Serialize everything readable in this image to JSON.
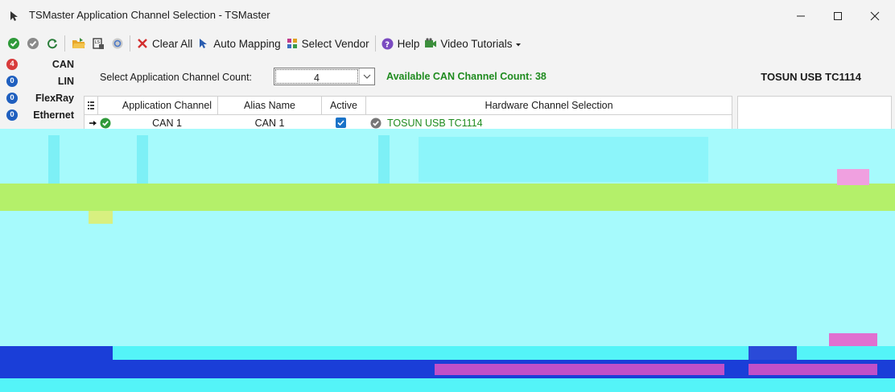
{
  "window": {
    "title": "TSMaster Application Channel Selection - TSMaster",
    "minimize": "minimize",
    "maximize": "maximize",
    "close": "close"
  },
  "toolbar": {
    "icons": [
      "ok-icon",
      "cancel-icon",
      "refresh-icon",
      "open-folder-icon",
      "save-config-icon",
      "reset-icon"
    ],
    "clear_all": "Clear All",
    "auto_mapping": "Auto Mapping",
    "select_vendor": "Select Vendor",
    "help": "Help",
    "video_tutorials": "Video Tutorials"
  },
  "categories": [
    {
      "name": "CAN",
      "count": "4",
      "color": "#d83b3b"
    },
    {
      "name": "LIN",
      "count": "0",
      "color": "#1f5fbf"
    },
    {
      "name": "FlexRay",
      "count": "0",
      "color": "#1f5fbf"
    },
    {
      "name": "Ethernet",
      "count": "0",
      "color": "#1f5fbf"
    }
  ],
  "selection": {
    "label": "Select Application Channel Count:",
    "count": "4",
    "available": "Available CAN Channel Count: 38",
    "device": "TOSUN USB TC1114"
  },
  "grid": {
    "headers": [
      "Application Channel",
      "Alias Name",
      "Active",
      "Hardware Channel Selection"
    ],
    "rows": [
      {
        "channel": "CAN 1",
        "alias": "CAN 1",
        "active": true,
        "hardware": "TOSUN USB TC1114"
      }
    ]
  },
  "colors": {
    "accent_green": "#1f8b1f",
    "ok_green": "#2f9a3a",
    "check_blue": "#1a73c8"
  }
}
